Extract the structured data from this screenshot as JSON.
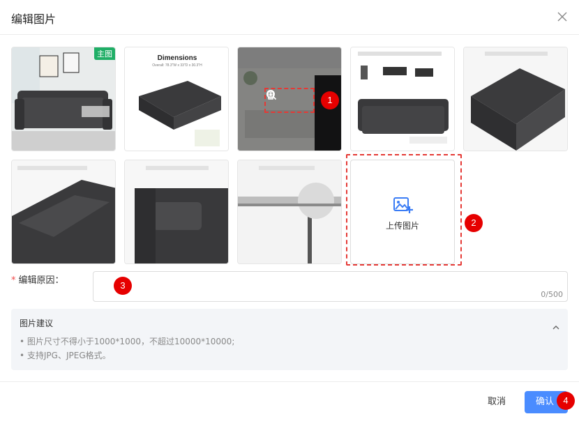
{
  "dialog": {
    "title": "编辑图片",
    "close_icon": "close-icon"
  },
  "images": [
    {
      "badge": "主图"
    },
    {
      "caption": "Dimensions",
      "subcaption": "Overall: 78.3\"W x 33\"D x 30.3\"H"
    },
    {
      "caption": "",
      "hovered": true
    },
    {
      "caption": ""
    },
    {
      "caption": ""
    },
    {
      "caption": ""
    },
    {
      "caption": ""
    },
    {
      "caption": ""
    }
  ],
  "hover_actions": [
    {
      "icon": "trash-icon"
    },
    {
      "icon": "zoom-in-icon"
    }
  ],
  "upload": {
    "label": "上传图片",
    "icon": "image-plus-icon"
  },
  "reason": {
    "required_mark": "*",
    "label": "编辑原因：",
    "value": "",
    "counter": "0/500"
  },
  "tips": {
    "title": "图片建议",
    "lines": [
      "• 图片尺寸不得小于1000*1000，不超过10000*10000;",
      "• 支持JPG、JPEG格式。"
    ],
    "collapse_icon": "chevron-up-icon"
  },
  "footer": {
    "cancel_label": "取消",
    "confirm_label": "确认"
  },
  "markers": [
    "1",
    "2",
    "3",
    "4"
  ],
  "colors": {
    "primary": "#4a8cff",
    "badge": "#1fae66",
    "marker": "#e60000",
    "sofa": "#3c3c3e"
  }
}
